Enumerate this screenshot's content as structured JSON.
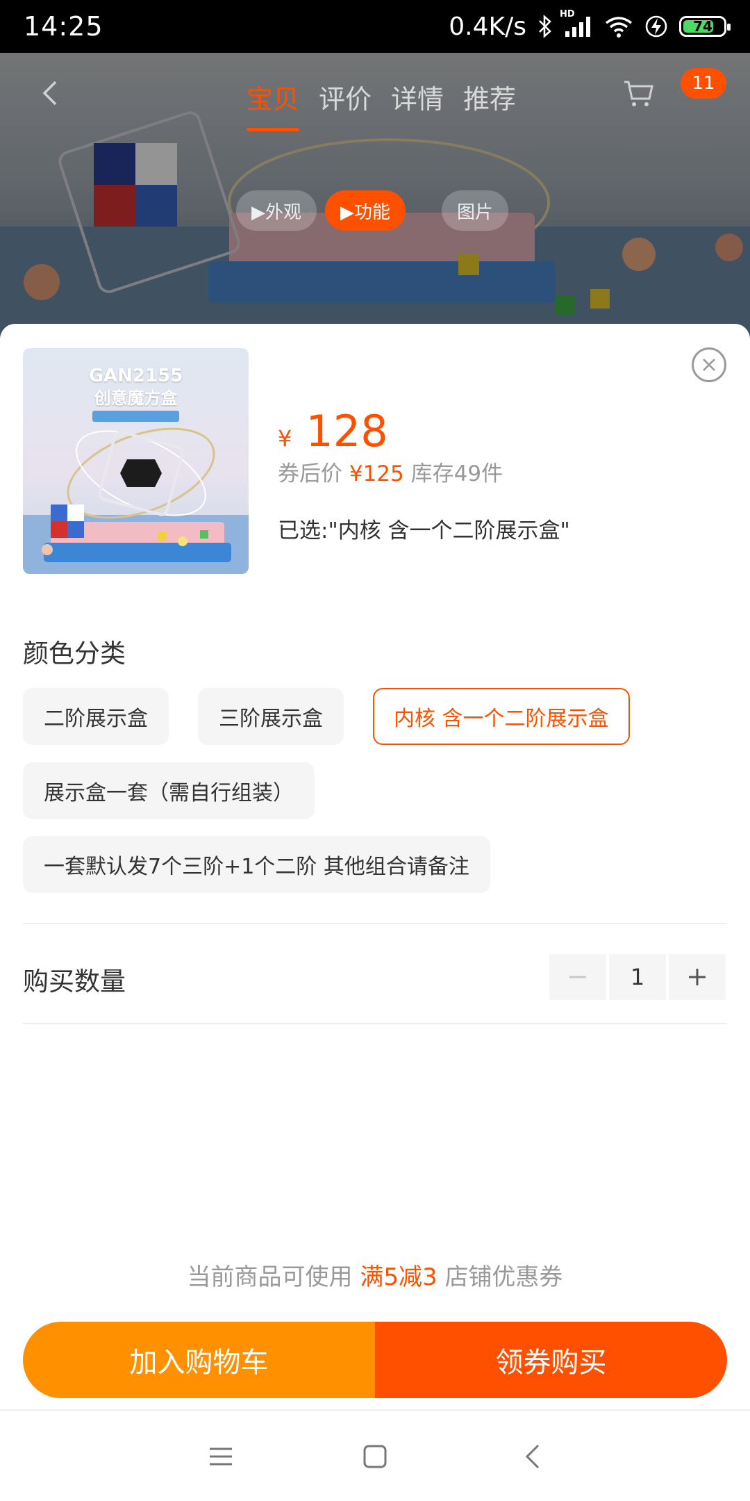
{
  "status_bar": {
    "time": "14:25",
    "network_speed": "0.4K/s",
    "signal_label": "HD",
    "battery_percent": "74"
  },
  "background_page": {
    "nav_tabs": [
      {
        "label": "宝贝",
        "active": true
      },
      {
        "label": "评价",
        "active": false
      },
      {
        "label": "详情",
        "active": false
      },
      {
        "label": "推荐",
        "active": false
      }
    ],
    "cart_badge": "11",
    "media_tabs": [
      {
        "label": "▶外观",
        "active": false
      },
      {
        "label": "▶功能",
        "active": true
      },
      {
        "label": "图片",
        "active": false
      }
    ]
  },
  "product": {
    "image_title_line1": "GAN2155",
    "image_title_line2": "创意魔方盒",
    "currency_symbol": "¥",
    "price": "128",
    "coupon_label": "券后价",
    "coupon_price": "¥125",
    "stock": "库存49件",
    "selected_text": "已选:\"内核 含一个二阶展示盒\""
  },
  "variants": {
    "title": "颜色分类",
    "options": [
      {
        "label": "二阶展示盒",
        "selected": false
      },
      {
        "label": "三阶展示盒",
        "selected": false
      },
      {
        "label": "内核 含一个二阶展示盒",
        "selected": true
      },
      {
        "label": "展示盒一套（需自行组装）",
        "selected": false
      },
      {
        "label": "一套默认发7个三阶+1个二阶 其他组合请备注",
        "selected": false
      }
    ]
  },
  "quantity": {
    "label": "购买数量",
    "value": "1"
  },
  "promo": {
    "prefix": "当前商品可使用",
    "highlight": "满5减3",
    "suffix": "店铺优惠券"
  },
  "actions": {
    "add_to_cart": "加入购物车",
    "buy_with_coupon": "领券购买"
  },
  "colors": {
    "accent": "#ff5000",
    "cart_button": "#ff9000",
    "buy_button": "#ff5000"
  }
}
